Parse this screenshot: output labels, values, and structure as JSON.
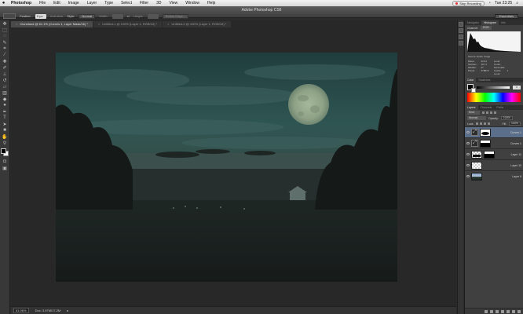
{
  "menubar": {
    "items": [
      "Photoshop",
      "File",
      "Edit",
      "Image",
      "Layer",
      "Type",
      "Select",
      "Filter",
      "3D",
      "View",
      "Window",
      "Help"
    ],
    "recording": "Stop Recording",
    "clock": "Tue 23:25"
  },
  "window": {
    "title": "Adobe Photoshop CS6"
  },
  "options": {
    "feather_label": "Feather:",
    "feather_value": "0 px",
    "antialias": "Anti-alias",
    "style_label": "Style:",
    "style_value": "Normal",
    "width_label": "Width:",
    "height_label": "Height:",
    "refine": "Refine Edge...",
    "workspace": "Essentials"
  },
  "tabs": [
    {
      "label": "Cloneland @ 61.1% (Curves 1, Layer Mask/16) *",
      "active": true
    },
    {
      "label": "Untitled-1 @ 100% (Layer 1, RGB/16) *",
      "active": false
    },
    {
      "label": "Untitled-2 @ 100% (Layer 1, RGB/16) *",
      "active": false
    }
  ],
  "status": {
    "zoom": "61.06%",
    "doc": "Doc: 3.07M/17.2M"
  },
  "histogram": {
    "tabs": [
      "Navigator",
      "Histogram",
      "Info"
    ],
    "channel_label": "Channel:",
    "channel_value": "RGB",
    "source_label": "Source:",
    "source_value": "Entire Image",
    "stats": [
      [
        "Mean:",
        "32.61",
        "Level:",
        ""
      ],
      [
        "Std Dev:",
        "18.71",
        "Count:",
        ""
      ],
      [
        "Median:",
        "27",
        "Percentile:",
        ""
      ],
      [
        "Pixels:",
        "378870",
        "Cache Level:",
        "1"
      ]
    ]
  },
  "color": {
    "tabs": [
      "Color",
      "Swatches"
    ],
    "k_value": "0"
  },
  "adjustments": {
    "tabs": [
      "Layers",
      "Channels",
      "Paths"
    ]
  },
  "layers": {
    "kind_label": "Kind",
    "blend_mode": "Normal",
    "opacity_label": "Opacity:",
    "opacity_value": "100%",
    "lock_label": "Lock:",
    "fill_label": "Fill:",
    "fill_value": "100%",
    "items": [
      {
        "name": "Curves 1",
        "selected": true
      },
      {
        "name": "Curves 1",
        "selected": false
      },
      {
        "name": "Layer 11",
        "selected": false
      },
      {
        "name": "Layer 10",
        "selected": false
      },
      {
        "name": "Layer 9",
        "selected": false
      }
    ]
  },
  "icons": {
    "apple": "apple-icon",
    "eye": "eye-icon",
    "adjustment": "curves-adjustment-icon"
  }
}
